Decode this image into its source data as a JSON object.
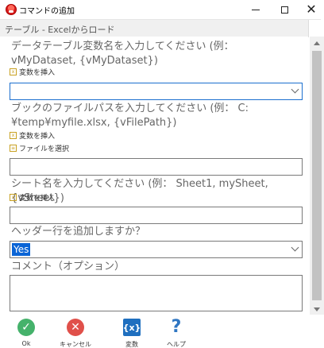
{
  "window": {
    "title": "コマンドの追加"
  },
  "header": {
    "text": "テーブル - Excelからロード"
  },
  "form": {
    "dataset_label": "データテーブル変数名を入力してください (例： vMyDataset, {vMyDataset})",
    "dataset_link": "変数を挿入",
    "dataset_value": "",
    "filepath_label": "ブックのファイルパスを入力してください (例： C:¥temp¥myfile.xlsx, {vFilePath})",
    "filepath_link": "変数を挿入",
    "filepath_file_link": "ファイルを選択",
    "filepath_value": "",
    "sheet_label": "シート名を入力してください (例： Sheet1, mySheet, {vSheet})",
    "sheet_link": "変数を挿入",
    "sheet_value": "",
    "header_label": "ヘッダー行を追加しますか？",
    "header_value": "Yes",
    "comment_label": "コメント（オプション）",
    "comment_value": ""
  },
  "footer": {
    "ok": "Ok",
    "cancel": "キャンセル",
    "variable": "変数",
    "variable_icon_text": "{x}",
    "help": "ヘルプ",
    "help_icon_text": "?"
  },
  "icons": {
    "app": "app-logo-icon",
    "ok": "check-icon",
    "cancel": "x-icon",
    "variable": "variable-icon",
    "help": "question-icon"
  },
  "colors": {
    "ok": "#45b26b",
    "cancel": "#e0504a",
    "variable": "#1f6fbf",
    "selection": "#0a64d6",
    "focus": "#1b6fcf"
  }
}
